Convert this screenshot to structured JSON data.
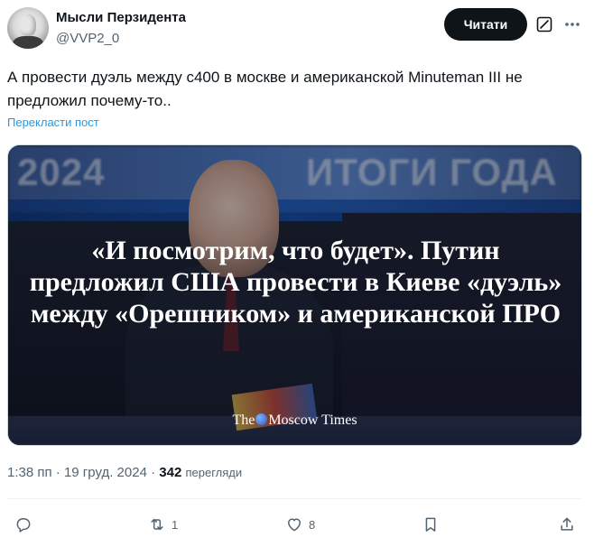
{
  "author": {
    "name": "Мысли Перзидента",
    "handle": "@VVP2_0"
  },
  "header": {
    "follow_label": "Читати",
    "grok_icon": "grok-icon",
    "more_icon": "more-icon"
  },
  "tweet": {
    "text": "А провести дуэль между с400 в москве и американской Minuteman III не предложил почему-то..",
    "translate_label": "Перекласти пост"
  },
  "media": {
    "background_left": "2024",
    "background_right": "ИТОГИ ГОДА",
    "headline": "«И посмотрим, что будет». Путин предложил США провести в Киеве «дуэль» между «Орешником» и американской ПРО",
    "brand_the": "The",
    "brand_rest": "Moscow Times"
  },
  "meta": {
    "time": "1:38 пп",
    "date": "19 груд. 2024",
    "separator": "·",
    "views_count": "342",
    "views_label": "перегляди"
  },
  "actions": {
    "reply_count": "",
    "retweet_count": "1",
    "like_count": "8",
    "icons": [
      "reply-icon",
      "retweet-icon",
      "like-icon",
      "bookmark-icon",
      "share-icon"
    ]
  },
  "colors": {
    "text": "#0f1419",
    "secondary": "#536471",
    "link": "#1d9bf0",
    "button_bg": "#0f1419"
  }
}
